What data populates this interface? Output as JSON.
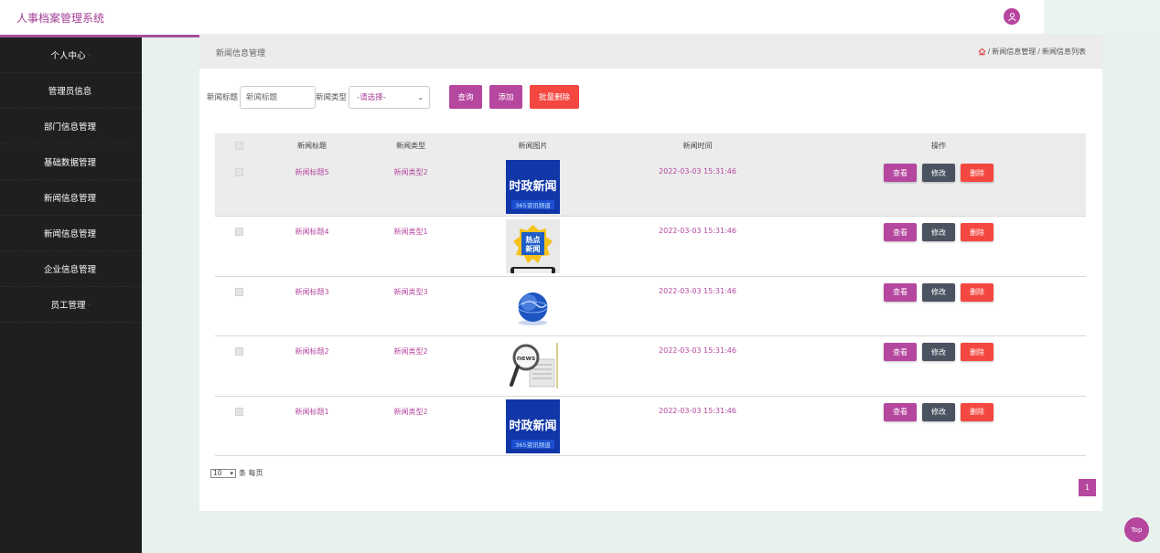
{
  "app": {
    "title": "人事档案管理系统"
  },
  "sidebar": {
    "items": [
      {
        "label": "个人中心",
        "chev": "▾"
      },
      {
        "label": "管理员信息",
        "chev": ""
      },
      {
        "label": "部门信息管理",
        "chev": ""
      },
      {
        "label": "基础数据管理",
        "chev": ""
      },
      {
        "label": "新闻信息管理",
        "chev": ""
      },
      {
        "label": "新闻信息管理",
        "chev": ""
      },
      {
        "label": "企业信息管理",
        "chev": ""
      },
      {
        "label": "员工管理",
        "chev": "▾"
      }
    ]
  },
  "header": {
    "page_title": "新闻信息管理",
    "breadcrumb": [
      "新闻信息管理",
      "新闻信息列表"
    ],
    "breadcrumb_sep": "/"
  },
  "search": {
    "title_label": "新闻标题",
    "title_placeholder": "新闻标题",
    "type_label": "新闻类型",
    "type_value": "-请选择-",
    "query_button": "查询",
    "add_button": "添加",
    "batch_delete_button": "批量删除"
  },
  "table": {
    "columns": [
      "新闻标题",
      "新闻类型",
      "新闻图片",
      "新闻时间",
      "操作"
    ],
    "rows": [
      {
        "title": "新闻标题5",
        "type": "新闻类型2",
        "image": "news-image-politics",
        "time": "2022-03-03 15:31:46"
      },
      {
        "title": "新闻标题4",
        "type": "新闻类型1",
        "image": "news-image-hotspot",
        "time": "2022-03-03 15:31:46"
      },
      {
        "title": "新闻标题3",
        "type": "新闻类型3",
        "image": "news-image-globe",
        "time": "2022-03-03 15:31:46"
      },
      {
        "title": "新闻标题2",
        "type": "新闻类型2",
        "image": "news-image-magnifier",
        "time": "2022-03-03 15:31:46"
      },
      {
        "title": "新闻标题1",
        "type": "新闻类型2",
        "image": "news-image-politics",
        "time": "2022-03-03 15:31:46"
      }
    ],
    "actions": {
      "view": "查看",
      "edit": "修改",
      "delete": "删除"
    }
  },
  "images": {
    "politics_main": "时政新闻",
    "politics_sub": "365资讯频道",
    "hotspot_text_1": "热点",
    "hotspot_text_2": "新闻",
    "magnifier_label": "news"
  },
  "pagination": {
    "page_size": "10",
    "page_size_suffix": "条 每页",
    "current_page": "1"
  },
  "back_to_top": "Top",
  "colors": {
    "accent": "#b5479f",
    "danger": "#f4473f",
    "dark_button": "#4b5260",
    "sidebar": "#1f1f1f"
  }
}
